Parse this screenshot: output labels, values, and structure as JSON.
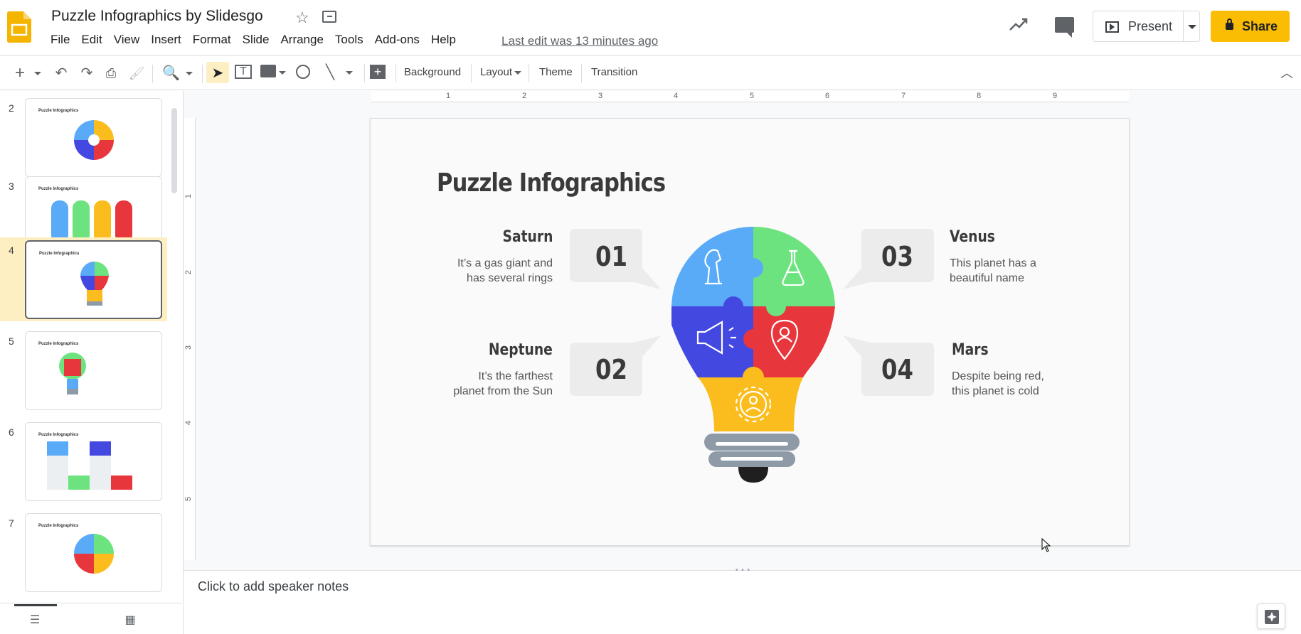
{
  "app": {
    "title": "Puzzle Infographics by Slidesgo",
    "last_edit": "Last edit was 13 minutes ago"
  },
  "menu": [
    "File",
    "Edit",
    "View",
    "Insert",
    "Format",
    "Slide",
    "Arrange",
    "Tools",
    "Add-ons",
    "Help"
  ],
  "header_buttons": {
    "present": "Present",
    "share": "Share"
  },
  "toolbar": {
    "background": "Background",
    "layout": "Layout",
    "theme": "Theme",
    "transition": "Transition"
  },
  "ruler_h": [
    "1",
    "2",
    "3",
    "4",
    "5",
    "6",
    "7",
    "8",
    "9"
  ],
  "ruler_v": [
    "1",
    "2",
    "3",
    "4",
    "5"
  ],
  "thumbnails": [
    {
      "num": "2",
      "title": "Puzzle Infographics"
    },
    {
      "num": "3",
      "title": "Puzzle Infographics"
    },
    {
      "num": "4",
      "title": "Puzzle Infographics"
    },
    {
      "num": "5",
      "title": "Puzzle Infographics"
    },
    {
      "num": "6",
      "title": "Puzzle Infographics"
    },
    {
      "num": "7",
      "title": "Puzzle Infographics"
    }
  ],
  "slide": {
    "title": "Puzzle Infographics",
    "items": [
      {
        "num": "01",
        "name": "Saturn",
        "text1": "It’s a gas giant and",
        "text2": "has several rings"
      },
      {
        "num": "02",
        "name": "Neptune",
        "text1": "It’s the farthest",
        "text2": "planet from the Sun"
      },
      {
        "num": "03",
        "name": "Venus",
        "text1": "This planet has a",
        "text2": "beautiful name"
      },
      {
        "num": "04",
        "name": "Mars",
        "text1": "Despite being red,",
        "text2": "this planet is cold"
      }
    ]
  },
  "notes": {
    "placeholder": "Click to add speaker notes"
  },
  "colors": {
    "accent": "#fbbc04",
    "blue": "#5aabf7",
    "green": "#6ce37f",
    "indigo": "#4248e0",
    "red": "#e8373c",
    "yellow": "#fbbd1e",
    "gray_base": "#8e9aa6"
  }
}
